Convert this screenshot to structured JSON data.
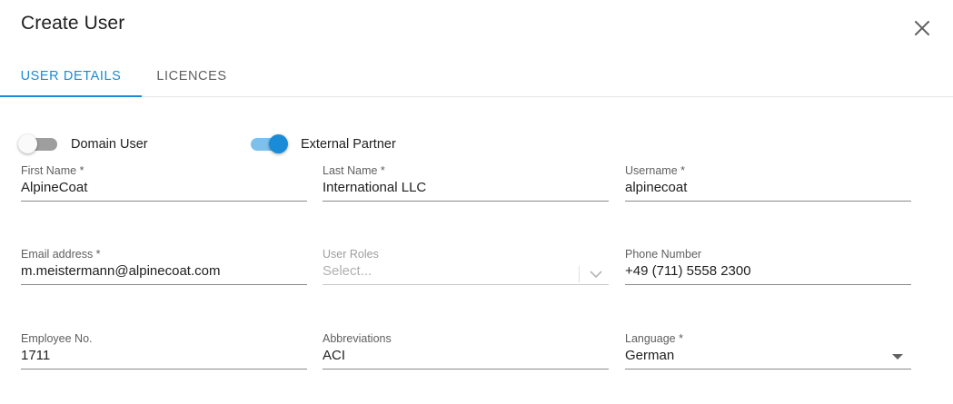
{
  "dialog": {
    "title": "Create User",
    "close_icon": "close-icon"
  },
  "tabs": [
    {
      "label": "USER DETAILS",
      "active": true
    },
    {
      "label": "LICENCES",
      "active": false
    }
  ],
  "toggles": [
    {
      "label": "Domain User",
      "checked": false
    },
    {
      "label": "External Partner",
      "checked": true
    }
  ],
  "fields": {
    "first_name": {
      "label": "First Name *",
      "value": "AlpineCoat"
    },
    "last_name": {
      "label": "Last Name *",
      "value": "International LLC"
    },
    "username": {
      "label": "Username *",
      "value": "alpinecoat"
    },
    "email": {
      "label": "Email address *",
      "value": "m.meistermann@alpinecoat.com"
    },
    "user_roles": {
      "label": "User Roles",
      "placeholder": "Select...",
      "icon": "chevron-down-icon"
    },
    "phone": {
      "label": "Phone Number",
      "value": "+49 (711) 5558 2300"
    },
    "employee_no": {
      "label": "Employee No.",
      "value": "1711"
    },
    "abbreviations": {
      "label": "Abbreviations",
      "value": "ACI"
    },
    "language": {
      "label": "Language *",
      "value": "German",
      "icon": "caret-down-icon"
    }
  },
  "colors": {
    "accent": "#1a8bd6",
    "accent_light": "#7ec0ec",
    "toggle_off": "#9e9e9e"
  }
}
